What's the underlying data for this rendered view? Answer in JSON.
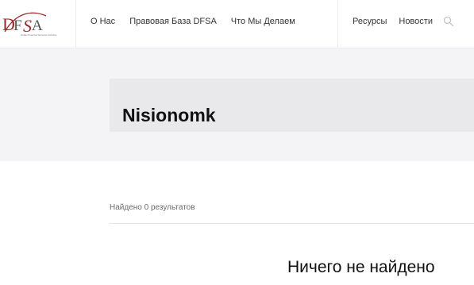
{
  "header": {
    "logo": {
      "mark": "DFSA",
      "tagline": "Dubai Financial Services Authority",
      "colors": {
        "red": "#a3282c",
        "gray": "#555555"
      }
    },
    "nav_left": [
      {
        "label": "О Нас"
      },
      {
        "label": "Правовая База DFSA"
      },
      {
        "label": "Что Мы Делаем"
      }
    ],
    "nav_right": [
      {
        "label": "Ресурсы"
      },
      {
        "label": "Новости"
      }
    ],
    "search_icon": "search-icon"
  },
  "hero": {
    "title": "Nisionomk"
  },
  "results": {
    "count_text": "Найдено 0 результатов",
    "empty_message": "Ничего не найдено"
  }
}
